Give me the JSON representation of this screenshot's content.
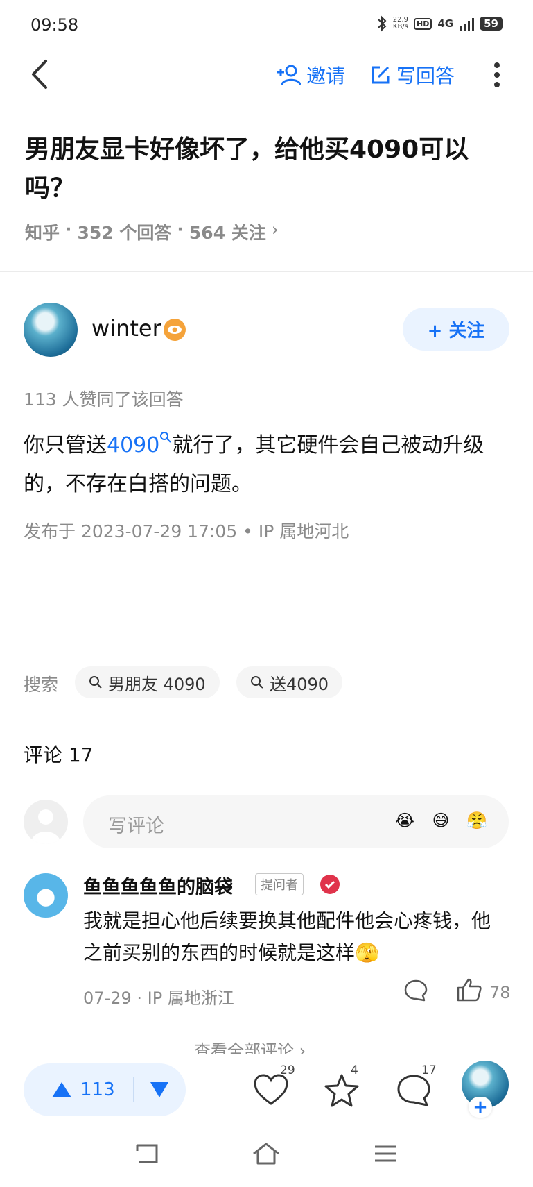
{
  "status_bar": {
    "time": "09:58",
    "net_speed_value": "22.9",
    "net_speed_unit": "KB/s",
    "hd": "HD",
    "signal": "4G",
    "battery": "59"
  },
  "header": {
    "invite_label": "邀请",
    "write_answer_label": "写回答"
  },
  "question": {
    "title": "男朋友显卡好像坏了，给他买4090可以吗？",
    "source": "知乎",
    "answers": "352 个回答",
    "followers": "564 关注"
  },
  "answer": {
    "author": "winter",
    "follow_label": "+ 关注",
    "vote_text": "113 人赞同了该回答",
    "content_before": "你只管送",
    "content_link": "4090",
    "content_after": "就行了，其它硬件会自己被动升级的，不存在白搭的问题。",
    "published": "发布于 2023-07-29 17:05 • IP 属地河北"
  },
  "search": {
    "label": "搜索",
    "chips": [
      "男朋友 4090",
      "送4090"
    ]
  },
  "comments": {
    "title": "评论 17",
    "input_placeholder": "写评论",
    "items": [
      {
        "author": "鱼鱼鱼鱼鱼的脑袋",
        "tag": "提问者",
        "text": "我就是担心他后续要换其他配件他会心疼钱，他之前买别的东西的时候就是这样🫣",
        "meta": "07-29 · IP 属地浙江",
        "likes": "78"
      }
    ],
    "view_all": "查看全部评论 ›"
  },
  "bottom_bar": {
    "upvotes": "113",
    "likes": "29",
    "favorites": "4",
    "comments": "17"
  },
  "emojis": [
    "😭",
    "😅",
    "😤"
  ],
  "colors": {
    "accent": "#1772f6",
    "muted": "#8a8a8a"
  }
}
